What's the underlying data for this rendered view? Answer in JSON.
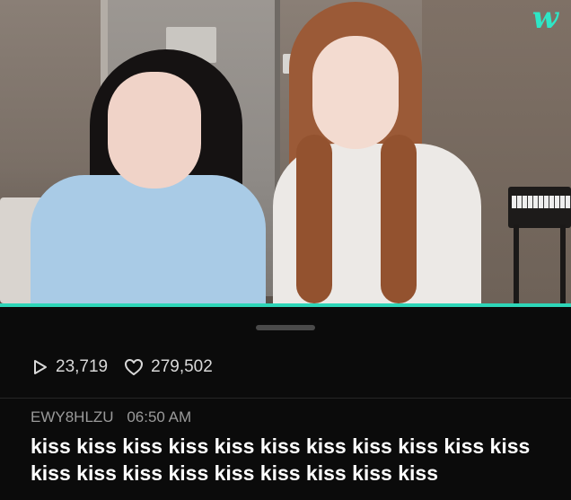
{
  "video": {
    "logo": "w"
  },
  "stats": {
    "plays": "23,719",
    "likes": "279,502",
    "play_icon": "play-outline-icon",
    "heart_icon": "heart-outline-icon"
  },
  "comment": {
    "username": "EWY8HLZU",
    "time": "06:50 AM",
    "text": "kiss kiss kiss kiss kiss kiss kiss kiss kiss kiss kiss kiss kiss kiss kiss kiss kiss kiss kiss kiss"
  },
  "colors": {
    "accent": "#2ed6b8",
    "background": "#0b0b0b"
  }
}
